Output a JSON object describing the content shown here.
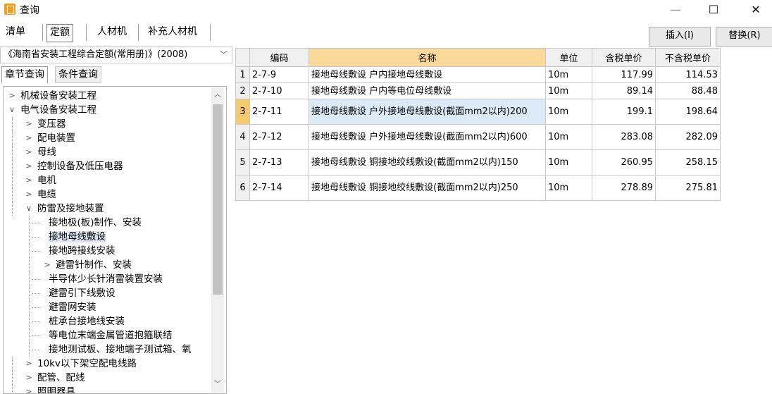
{
  "window": {
    "title": "查询"
  },
  "top_tabs": [
    "清单",
    "定额",
    "人材机",
    "补充人材机"
  ],
  "buttons": {
    "insert": "插入(I)",
    "replace": "替换(R)"
  },
  "library": {
    "selected": "《海南省安装工程综合定额(常用册)》(2008)"
  },
  "sub_tabs": [
    "章节查询",
    "条件查询"
  ],
  "tree": [
    {
      "label": "机械设备安装工程",
      "level": 0,
      "expander": "collapsed"
    },
    {
      "label": "电气设备安装工程",
      "level": 0,
      "expander": "expanded"
    },
    {
      "label": "变压器",
      "level": 1,
      "expander": "collapsed"
    },
    {
      "label": "配电装置",
      "level": 1,
      "expander": "collapsed"
    },
    {
      "label": "母线",
      "level": 1,
      "expander": "collapsed"
    },
    {
      "label": "控制设备及低压电器",
      "level": 1,
      "expander": "collapsed"
    },
    {
      "label": "电机",
      "level": 1,
      "expander": "collapsed"
    },
    {
      "label": "电缆",
      "level": 1,
      "expander": "collapsed"
    },
    {
      "label": "防雷及接地装置",
      "level": 1,
      "expander": "expanded"
    },
    {
      "label": "接地极(板)制作、安装",
      "level": 2,
      "expander": "none"
    },
    {
      "label": "接地母线敷设",
      "level": 2,
      "expander": "none",
      "selected": true
    },
    {
      "label": "接地跨接线安装",
      "level": 2,
      "expander": "none"
    },
    {
      "label": "避雷针制作、安装",
      "level": 2,
      "expander": "collapsed"
    },
    {
      "label": "半导体少长针消雷装置安装",
      "level": 2,
      "expander": "none"
    },
    {
      "label": "避雷引下线敷设",
      "level": 2,
      "expander": "none"
    },
    {
      "label": "避雷网安装",
      "level": 2,
      "expander": "none"
    },
    {
      "label": "桩承台接地线安装",
      "level": 2,
      "expander": "none"
    },
    {
      "label": "等电位末端金属管道抱箍联结",
      "level": 2,
      "expander": "none"
    },
    {
      "label": "接地测试板、接地端子测试箱、氧",
      "level": 2,
      "expander": "none"
    },
    {
      "label": "10kv以下架空配电线路",
      "level": 1,
      "expander": "collapsed"
    },
    {
      "label": "配管、配线",
      "level": 1,
      "expander": "collapsed"
    },
    {
      "label": "照明器具",
      "level": 1,
      "expander": "collapsed"
    }
  ],
  "grid": {
    "columns": [
      "",
      "编码",
      "名称",
      "单位",
      "含税单价",
      "不含税单价"
    ],
    "rows": [
      {
        "idx": "1",
        "code": "2-7-9",
        "name": "接地母线敷设 户内接地母线敷设",
        "unit": "10m",
        "tax_price": "117.99",
        "notax_price": "114.53"
      },
      {
        "idx": "2",
        "code": "2-7-10",
        "name": "接地母线敷设 户内等电位母线敷设",
        "unit": "10m",
        "tax_price": "89.14",
        "notax_price": "88.48"
      },
      {
        "idx": "3",
        "code": "2-7-11",
        "name": "接地母线敷设 户外接地母线敷设(截面mm2以内)200",
        "unit": "10m",
        "tax_price": "199.1",
        "notax_price": "198.64",
        "selected": true
      },
      {
        "idx": "4",
        "code": "2-7-12",
        "name": "接地母线敷设 户外接地母线敷设(截面mm2以内)600",
        "unit": "10m",
        "tax_price": "283.08",
        "notax_price": "282.09"
      },
      {
        "idx": "5",
        "code": "2-7-13",
        "name": "接地母线敷设 铜接地绞线敷设(截面mm2以内)150",
        "unit": "10m",
        "tax_price": "260.95",
        "notax_price": "258.15"
      },
      {
        "idx": "6",
        "code": "2-7-14",
        "name": "接地母线敷设 铜接地绞线敷设(截面mm2以内)250",
        "unit": "10m",
        "tax_price": "278.89",
        "notax_price": "275.81"
      }
    ]
  }
}
